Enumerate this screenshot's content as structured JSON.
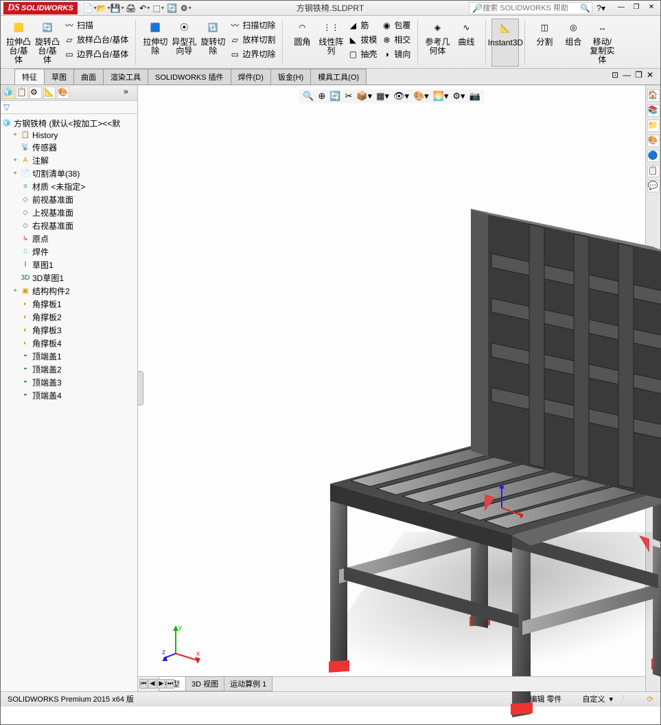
{
  "title_file": "方钢铁椅.SLDPRT",
  "logo_text": "SOLIDWORKS",
  "search_placeholder": "搜索 SOLIDWORKS 帮助",
  "ribbon": {
    "extrude_boss": "拉伸凸台/基体",
    "revolve_boss": "旋转凸台/基体",
    "sweep": "扫描",
    "loft": "放样凸台/基体",
    "boundary": "边界凸台/基体",
    "extrude_cut": "拉伸切除",
    "hole_wizard": "异型孔向导",
    "revolve_cut": "旋转切除",
    "sweep_cut": "扫描切除",
    "loft_cut": "放样切割",
    "boundary_cut": "边界切除",
    "fillet": "圆角",
    "linear_pattern": "线性阵列",
    "rib": "筋",
    "draft": "拔模",
    "shell": "抽壳",
    "wrap": "包覆",
    "intersect": "相交",
    "mirror": "镜向",
    "ref_geom": "参考几何体",
    "curves": "曲线",
    "instant3d": "Instant3D",
    "split": "分割",
    "combine": "组合",
    "move_copy": "移动/复制实体"
  },
  "cmd_tabs": [
    "特征",
    "草图",
    "曲面",
    "渲染工具",
    "SOLIDWORKS 插件",
    "焊件(D)",
    "钣金(H)",
    "模具工具(O)"
  ],
  "cmd_active": 0,
  "tree": {
    "root": "方钢铁椅  (默认<按加工><<默",
    "nodes": [
      {
        "icon": "📋",
        "label": "History",
        "exp": "+"
      },
      {
        "icon": "📡",
        "label": "传感器"
      },
      {
        "icon": "A",
        "label": "注解",
        "exp": "+",
        "iconColor": "#d4a000"
      },
      {
        "icon": "📄",
        "label": "切割清单(38)",
        "exp": "+"
      },
      {
        "icon": "≡",
        "label": "材质 <未指定>",
        "iconColor": "#3a8"
      },
      {
        "icon": "◇",
        "label": "前视基准面"
      },
      {
        "icon": "◇",
        "label": "上视基准面"
      },
      {
        "icon": "◇",
        "label": "右视基准面"
      },
      {
        "icon": "↳",
        "label": "原点",
        "iconColor": "#c33"
      },
      {
        "icon": "⎍",
        "label": "焊件",
        "iconColor": "#2a8"
      },
      {
        "icon": "⌇",
        "label": "草图1",
        "iconColor": "#167"
      },
      {
        "icon": "3D",
        "label": "3D草图1",
        "iconColor": "#167"
      },
      {
        "icon": "▣",
        "label": "结构构件2",
        "exp": "+",
        "iconColor": "#d4a000"
      },
      {
        "icon": "◐",
        "label": "角撑板1",
        "iconColor": "#d4a000"
      },
      {
        "icon": "◐",
        "label": "角撑板2",
        "iconColor": "#d4a000"
      },
      {
        "icon": "◐",
        "label": "角撑板3",
        "iconColor": "#d4a000"
      },
      {
        "icon": "◐",
        "label": "角撑板4",
        "iconColor": "#d4a000"
      },
      {
        "icon": "◓",
        "label": "顶端盖1",
        "iconColor": "#1a8a1a"
      },
      {
        "icon": "◓",
        "label": "顶端盖2",
        "iconColor": "#1a8a1a"
      },
      {
        "icon": "◓",
        "label": "顶端盖3",
        "iconColor": "#1a8a1a"
      },
      {
        "icon": "◓",
        "label": "顶端盖4",
        "iconColor": "#1a8a1a"
      }
    ]
  },
  "bottom_tabs": [
    "模型",
    "3D 视图",
    "运动算例 1"
  ],
  "bottom_active": 0,
  "status_left": "SOLIDWORKS Premium 2015 x64 版",
  "status_editing": "在编辑 零件",
  "status_custom": "自定义",
  "triad": {
    "x": "x",
    "y": "y",
    "z": "z"
  }
}
